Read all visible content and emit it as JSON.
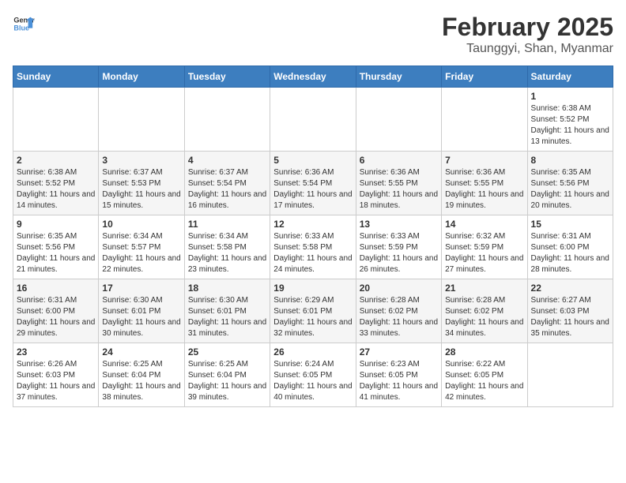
{
  "header": {
    "logo_general": "General",
    "logo_blue": "Blue",
    "month_title": "February 2025",
    "location": "Taunggyi, Shan, Myanmar"
  },
  "weekdays": [
    "Sunday",
    "Monday",
    "Tuesday",
    "Wednesday",
    "Thursday",
    "Friday",
    "Saturday"
  ],
  "weeks": [
    [
      {
        "day": "",
        "info": ""
      },
      {
        "day": "",
        "info": ""
      },
      {
        "day": "",
        "info": ""
      },
      {
        "day": "",
        "info": ""
      },
      {
        "day": "",
        "info": ""
      },
      {
        "day": "",
        "info": ""
      },
      {
        "day": "1",
        "info": "Sunrise: 6:38 AM\nSunset: 5:52 PM\nDaylight: 11 hours and 13 minutes."
      }
    ],
    [
      {
        "day": "2",
        "info": "Sunrise: 6:38 AM\nSunset: 5:52 PM\nDaylight: 11 hours and 14 minutes."
      },
      {
        "day": "3",
        "info": "Sunrise: 6:37 AM\nSunset: 5:53 PM\nDaylight: 11 hours and 15 minutes."
      },
      {
        "day": "4",
        "info": "Sunrise: 6:37 AM\nSunset: 5:54 PM\nDaylight: 11 hours and 16 minutes."
      },
      {
        "day": "5",
        "info": "Sunrise: 6:36 AM\nSunset: 5:54 PM\nDaylight: 11 hours and 17 minutes."
      },
      {
        "day": "6",
        "info": "Sunrise: 6:36 AM\nSunset: 5:55 PM\nDaylight: 11 hours and 18 minutes."
      },
      {
        "day": "7",
        "info": "Sunrise: 6:36 AM\nSunset: 5:55 PM\nDaylight: 11 hours and 19 minutes."
      },
      {
        "day": "8",
        "info": "Sunrise: 6:35 AM\nSunset: 5:56 PM\nDaylight: 11 hours and 20 minutes."
      }
    ],
    [
      {
        "day": "9",
        "info": "Sunrise: 6:35 AM\nSunset: 5:56 PM\nDaylight: 11 hours and 21 minutes."
      },
      {
        "day": "10",
        "info": "Sunrise: 6:34 AM\nSunset: 5:57 PM\nDaylight: 11 hours and 22 minutes."
      },
      {
        "day": "11",
        "info": "Sunrise: 6:34 AM\nSunset: 5:58 PM\nDaylight: 11 hours and 23 minutes."
      },
      {
        "day": "12",
        "info": "Sunrise: 6:33 AM\nSunset: 5:58 PM\nDaylight: 11 hours and 24 minutes."
      },
      {
        "day": "13",
        "info": "Sunrise: 6:33 AM\nSunset: 5:59 PM\nDaylight: 11 hours and 26 minutes."
      },
      {
        "day": "14",
        "info": "Sunrise: 6:32 AM\nSunset: 5:59 PM\nDaylight: 11 hours and 27 minutes."
      },
      {
        "day": "15",
        "info": "Sunrise: 6:31 AM\nSunset: 6:00 PM\nDaylight: 11 hours and 28 minutes."
      }
    ],
    [
      {
        "day": "16",
        "info": "Sunrise: 6:31 AM\nSunset: 6:00 PM\nDaylight: 11 hours and 29 minutes."
      },
      {
        "day": "17",
        "info": "Sunrise: 6:30 AM\nSunset: 6:01 PM\nDaylight: 11 hours and 30 minutes."
      },
      {
        "day": "18",
        "info": "Sunrise: 6:30 AM\nSunset: 6:01 PM\nDaylight: 11 hours and 31 minutes."
      },
      {
        "day": "19",
        "info": "Sunrise: 6:29 AM\nSunset: 6:01 PM\nDaylight: 11 hours and 32 minutes."
      },
      {
        "day": "20",
        "info": "Sunrise: 6:28 AM\nSunset: 6:02 PM\nDaylight: 11 hours and 33 minutes."
      },
      {
        "day": "21",
        "info": "Sunrise: 6:28 AM\nSunset: 6:02 PM\nDaylight: 11 hours and 34 minutes."
      },
      {
        "day": "22",
        "info": "Sunrise: 6:27 AM\nSunset: 6:03 PM\nDaylight: 11 hours and 35 minutes."
      }
    ],
    [
      {
        "day": "23",
        "info": "Sunrise: 6:26 AM\nSunset: 6:03 PM\nDaylight: 11 hours and 37 minutes."
      },
      {
        "day": "24",
        "info": "Sunrise: 6:25 AM\nSunset: 6:04 PM\nDaylight: 11 hours and 38 minutes."
      },
      {
        "day": "25",
        "info": "Sunrise: 6:25 AM\nSunset: 6:04 PM\nDaylight: 11 hours and 39 minutes."
      },
      {
        "day": "26",
        "info": "Sunrise: 6:24 AM\nSunset: 6:05 PM\nDaylight: 11 hours and 40 minutes."
      },
      {
        "day": "27",
        "info": "Sunrise: 6:23 AM\nSunset: 6:05 PM\nDaylight: 11 hours and 41 minutes."
      },
      {
        "day": "28",
        "info": "Sunrise: 6:22 AM\nSunset: 6:05 PM\nDaylight: 11 hours and 42 minutes."
      },
      {
        "day": "",
        "info": ""
      }
    ]
  ]
}
